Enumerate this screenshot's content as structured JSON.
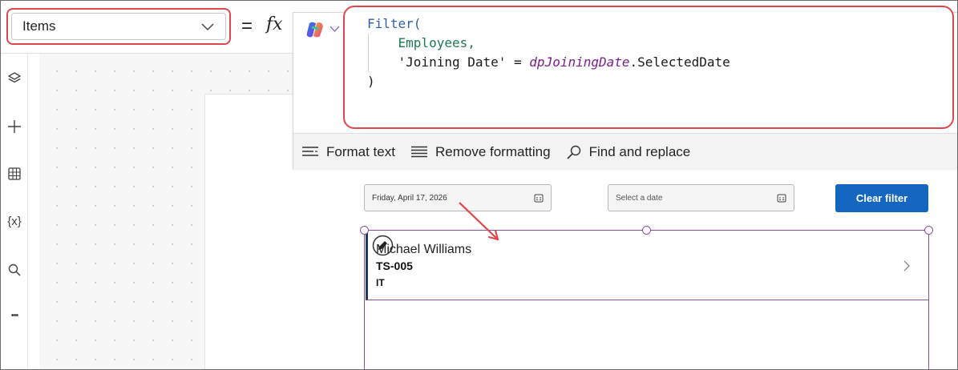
{
  "formula_bar": {
    "property": "Items",
    "equals": "=",
    "fx": "fx"
  },
  "formula": {
    "line1_fn": "Filter(",
    "line2_ds": "Employees,",
    "line3_field": "'Joining Date'",
    "line3_op": " = ",
    "line3_control": "dpJoiningDate",
    "line3_prop": ".SelectedDate",
    "line4": ")"
  },
  "format_toolbar": {
    "format_text": "Format text",
    "remove_formatting": "Remove formatting",
    "find_replace": "Find and replace"
  },
  "left_rail": {
    "icons": [
      "layers-icon",
      "plus-icon",
      "table-icon",
      "variables-icon",
      "search-icon",
      "more-icon"
    ],
    "variables_glyph": "{x}",
    "more_glyph": "•••"
  },
  "app": {
    "date_picker_1": "Friday, April 17, 2026",
    "date_picker_2_placeholder": "Select a date",
    "clear_button": "Clear filter",
    "gallery_item": {
      "name": "Michael Williams",
      "id": "TS-005",
      "department": "IT"
    }
  },
  "colors": {
    "annotation_red": "#e0474c",
    "selection_purple": "#8c4f9e",
    "button_blue": "#1466c0"
  }
}
